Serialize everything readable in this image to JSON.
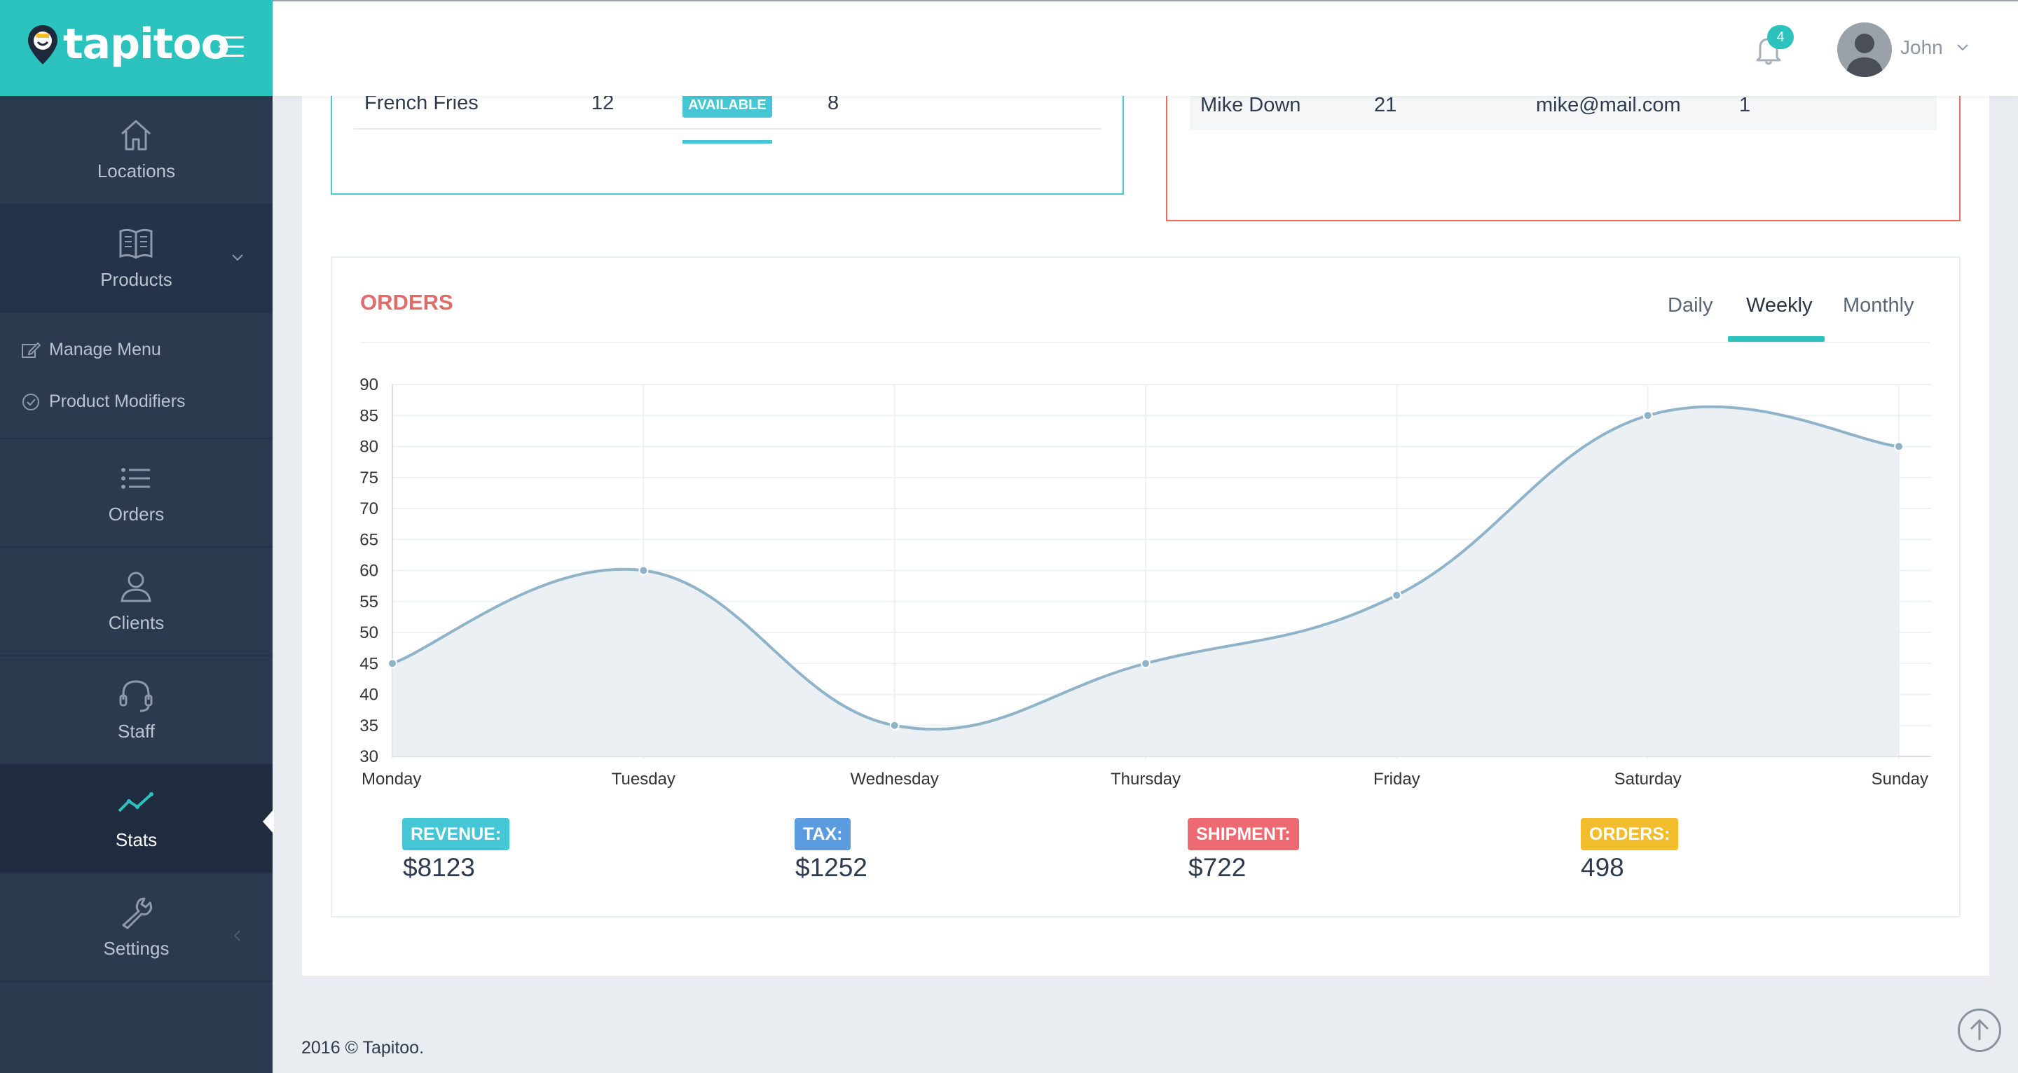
{
  "brand": {
    "name": "tapitoo"
  },
  "sidebar": {
    "items": [
      {
        "label": "Locations",
        "icon": "home-icon"
      },
      {
        "label": "Products",
        "icon": "book-icon"
      },
      {
        "label": "Orders",
        "icon": "list-icon"
      },
      {
        "label": "Clients",
        "icon": "user-icon"
      },
      {
        "label": "Staff",
        "icon": "headset-icon"
      },
      {
        "label": "Stats",
        "icon": "trend-icon"
      },
      {
        "label": "Settings",
        "icon": "wrench-icon"
      }
    ],
    "submenu": [
      {
        "label": "Manage Menu",
        "icon": "edit-icon"
      },
      {
        "label": "Product Modifiers",
        "icon": "check-circle-icon"
      }
    ]
  },
  "header": {
    "notification_count": "4",
    "user_name": "John"
  },
  "prev_left": {
    "row": {
      "name": "French Fries",
      "qty": "12",
      "status": "AVAILABLE",
      "count": "8"
    }
  },
  "prev_right": {
    "row": {
      "name": "Mike Down",
      "age": "21",
      "email": "mike@mail.com",
      "count": "1"
    }
  },
  "orders": {
    "title": "ORDERS",
    "tabs": [
      "Daily",
      "Weekly",
      "Monthly"
    ],
    "active_tab": "Weekly",
    "stats": [
      {
        "label": "REVENUE:",
        "value": "$8123",
        "color": "#45c6d4"
      },
      {
        "label": "TAX:",
        "value": "$1252",
        "color": "#5b9ce0"
      },
      {
        "label": "SHIPMENT:",
        "value": "$722",
        "color": "#ee6a72"
      },
      {
        "label": "ORDERS:",
        "value": "498",
        "color": "#f2bd2c"
      }
    ]
  },
  "chart_data": {
    "type": "area",
    "categories": [
      "Monday",
      "Tuesday",
      "Wednesday",
      "Thursday",
      "Friday",
      "Saturday",
      "Sunday"
    ],
    "values": [
      45,
      60,
      35,
      45,
      56,
      85,
      80
    ],
    "ylim": [
      30,
      90
    ],
    "yticks": [
      90,
      85,
      80,
      75,
      70,
      65,
      60,
      55,
      50,
      45,
      40,
      35,
      30
    ],
    "grid": true,
    "line_color": "#8fb3c8",
    "fill_color": "#e8eef2"
  },
  "footer": {
    "copyright": "2016 © Tapitoo."
  }
}
